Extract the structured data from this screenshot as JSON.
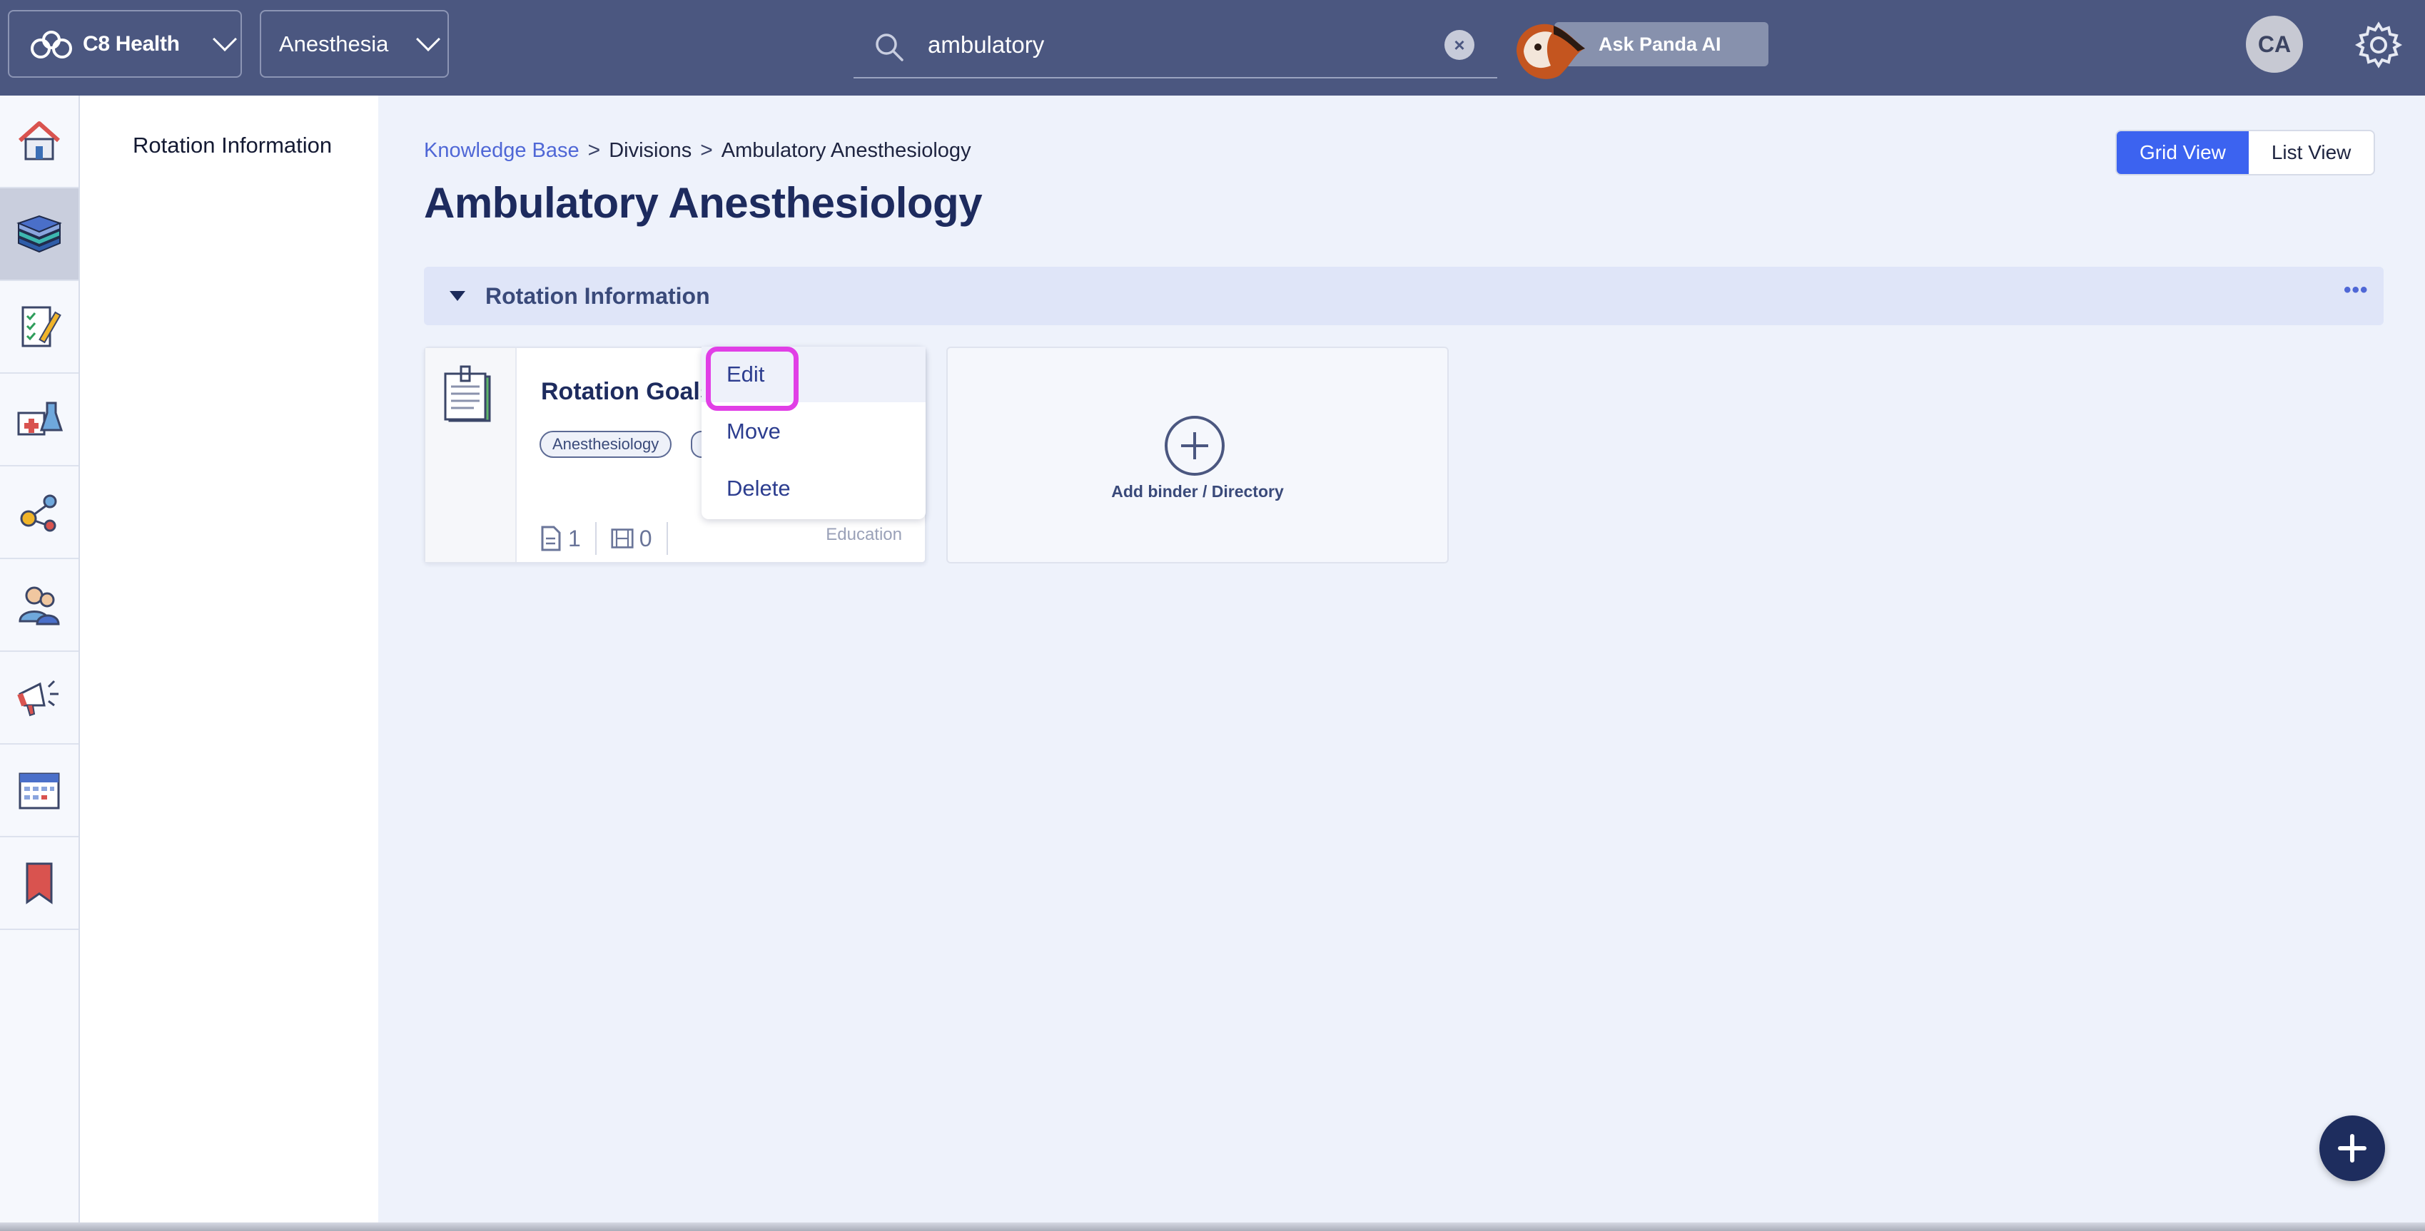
{
  "header": {
    "org_label": "C8 Health",
    "dept_label": "Anesthesia",
    "search_value": "ambulatory",
    "search_clear": "×",
    "ask_panda_label": "Ask Panda AI",
    "avatar_initials": "CA"
  },
  "rail": {
    "icons": [
      "home-icon",
      "books-icon",
      "checklist-icon",
      "medical-kit-icon",
      "network-icon",
      "people-icon",
      "megaphone-icon",
      "calendar-icon",
      "bookmark-icon"
    ],
    "active_index": 1
  },
  "subnav": {
    "items": [
      "Rotation Information"
    ]
  },
  "breadcrumb": {
    "root": "Knowledge Base",
    "sep": ">",
    "level1": "Divisions",
    "level2": "Ambulatory Anesthesiology"
  },
  "page": {
    "title": "Ambulatory Anesthesiology",
    "grid_view_label": "Grid View",
    "list_view_label": "List View"
  },
  "section": {
    "title": "Rotation Information",
    "more": "•••"
  },
  "card": {
    "name": "Rotation Goals",
    "tags": [
      "Anesthesiology"
    ],
    "doc_count": "1",
    "video_count": "0",
    "category": "Education"
  },
  "menu": {
    "items": [
      "Edit",
      "Move",
      "Delete"
    ]
  },
  "add_card": {
    "label": "Add binder / Directory"
  },
  "colors": {
    "topbar": "#4b5780",
    "accent": "#3c63f0",
    "focus_ring": "#e13fe6",
    "title": "#1d2b5e"
  }
}
